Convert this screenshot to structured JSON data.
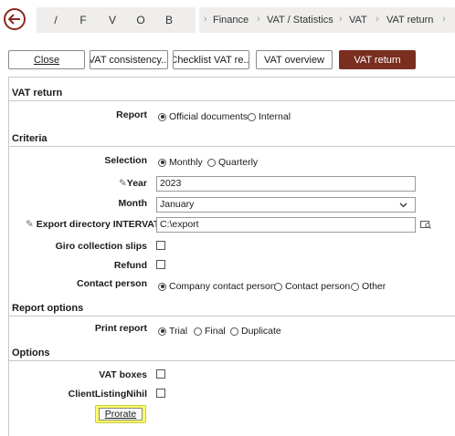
{
  "nav": {
    "buttons": [
      "/",
      "F",
      "V",
      "O",
      "B"
    ]
  },
  "breadcrumb": [
    "Finance",
    "VAT / Statistics",
    "VAT",
    "VAT return"
  ],
  "toolbar": {
    "close": "Close",
    "vat_consistency": "VAT consistency...",
    "checklist": "Checklist VAT re...",
    "vat_overview": "VAT overview",
    "vat_return": "VAT return"
  },
  "sections": {
    "vat_return": "VAT return",
    "criteria": "Criteria",
    "report_options": "Report options",
    "options": "Options"
  },
  "report": {
    "label": "Report",
    "options": [
      "Official documents",
      "Internal"
    ],
    "selected": "Official documents"
  },
  "selection": {
    "label": "Selection",
    "options": [
      "Monthly",
      "Quarterly"
    ],
    "selected": "Monthly"
  },
  "year": {
    "label": "Year",
    "value": "2023"
  },
  "month": {
    "label": "Month",
    "value": "January"
  },
  "export_dir": {
    "label": "Export directory INTERVAT",
    "value": "C:\\export"
  },
  "giro": {
    "label": "Giro collection slips",
    "checked": false
  },
  "refund": {
    "label": "Refund",
    "checked": false
  },
  "contact": {
    "label": "Contact person",
    "options": [
      "Company contact person",
      "Contact person",
      "Other"
    ],
    "selected": "Company contact person"
  },
  "print_report": {
    "label": "Print report",
    "options": [
      "Trial",
      "Final",
      "Duplicate"
    ],
    "selected": "Trial"
  },
  "vat_boxes": {
    "label": "VAT boxes",
    "checked": false
  },
  "client_listing": {
    "label": "ClientListingNihil",
    "checked": false
  },
  "prorate": {
    "label": "Prorate"
  },
  "colors": {
    "accent": "#7a2e20",
    "highlight": "#ffff66"
  }
}
